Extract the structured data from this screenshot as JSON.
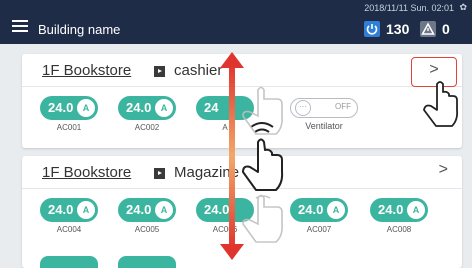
{
  "header": {
    "building_name": "Building name",
    "datetime": "2018/11/11 Sun. 02:01",
    "on_count": "130",
    "alarm_count": "0"
  },
  "groups": [
    {
      "floor": "1F Bookstore",
      "zone": "cashier",
      "units": [
        {
          "temp": "24.0",
          "label": "AC001"
        },
        {
          "temp": "24.0",
          "label": "AC002"
        },
        {
          "temp": "24",
          "label": "A"
        }
      ],
      "ventilator": {
        "state": "OFF",
        "label": "Ventilator"
      }
    },
    {
      "floor": "1F Bookstore",
      "zone": "Magazine",
      "units": [
        {
          "temp": "24.0",
          "label": "AC004"
        },
        {
          "temp": "24.0",
          "label": "AC005"
        },
        {
          "temp": "24.0",
          "label": "AC006"
        },
        {
          "temp": "24.0",
          "label": "AC007"
        },
        {
          "temp": "24.0",
          "label": "AC008"
        }
      ]
    }
  ],
  "colors": {
    "header_bg": "#1e2c47",
    "unit_on": "#3cb5a0",
    "highlight": "#e0453b",
    "scroll_arrow": "#e0352e"
  },
  "icons": {
    "menu": "hamburger-icon",
    "power": "power-icon",
    "alarm": "alarm-icon",
    "mode": "auto-mode-icon",
    "next": "chevron-right-icon",
    "gesture": "hand-pointer-icon"
  }
}
